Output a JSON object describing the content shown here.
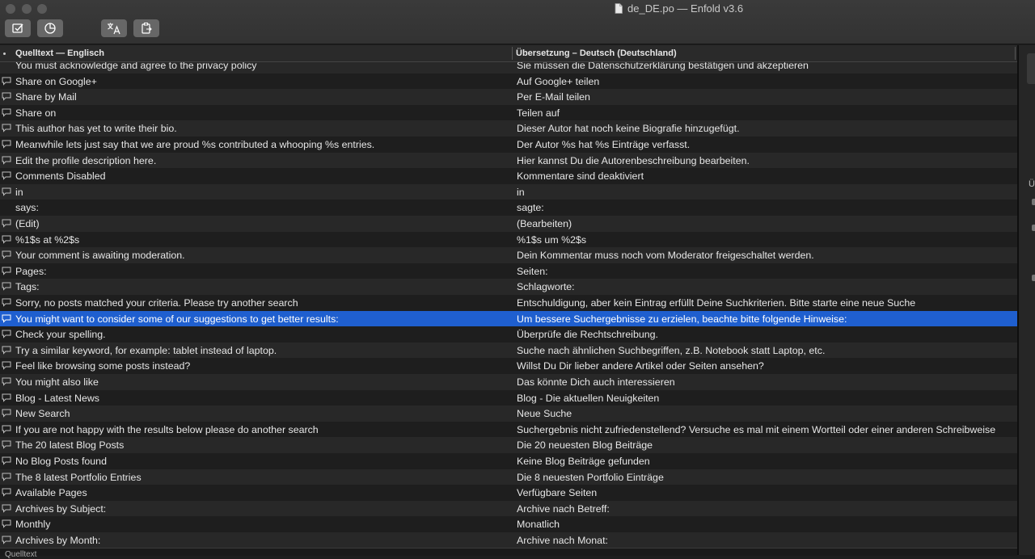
{
  "window": {
    "title": "de_DE.po — Enfold v3.6"
  },
  "toolbar": {
    "buttons": [
      {
        "icon": "checkmark-box-icon"
      },
      {
        "icon": "pie-chart-icon"
      },
      {
        "icon": "translate-icon"
      },
      {
        "icon": "clipboard-icon"
      }
    ]
  },
  "table": {
    "headers": {
      "source": "Quelltext — Englisch",
      "translation": "Übersetzung – Deutsch (Deutschland)"
    },
    "rows": [
      {
        "source": "You must acknowledge and agree to the privacy policy",
        "translation": "Sie müssen die Datenschutzerklärung bestätigen und akzeptieren",
        "comment": false
      },
      {
        "source": "Share on Google+",
        "translation": "Auf Google+ teilen",
        "comment": true
      },
      {
        "source": "Share by Mail",
        "translation": "Per E-Mail teilen",
        "comment": true
      },
      {
        "source": "Share on",
        "translation": "Teilen auf",
        "comment": true
      },
      {
        "source": "This author has yet to write their bio.",
        "translation": "Dieser Autor hat noch keine Biografie hinzugefügt.",
        "comment": true
      },
      {
        "source": "Meanwhile lets just say that we are proud %s contributed a whooping %s entries.",
        "translation": "Der Autor %s hat %s Einträge verfasst.",
        "comment": true
      },
      {
        "source": "Edit the profile description here.",
        "translation": "Hier kannst Du die Autorenbeschreibung bearbeiten.",
        "comment": true
      },
      {
        "source": "Comments Disabled",
        "translation": "Kommentare sind deaktiviert",
        "comment": true
      },
      {
        "source": "in",
        "translation": "in",
        "comment": true
      },
      {
        "source": "says:",
        "translation": "sagte:",
        "comment": false
      },
      {
        "source": "(Edit)",
        "translation": "(Bearbeiten)",
        "comment": true
      },
      {
        "source": "%1$s at %2$s",
        "translation": "%1$s um %2$s",
        "comment": true
      },
      {
        "source": "Your comment is awaiting moderation.",
        "translation": "Dein Kommentar muss noch vom Moderator freigeschaltet werden.",
        "comment": true
      },
      {
        "source": "Pages:",
        "translation": "Seiten:",
        "comment": true
      },
      {
        "source": "Tags:",
        "translation": "Schlagworte:",
        "comment": true
      },
      {
        "source": "Sorry, no posts matched your criteria. Please try another search",
        "translation": "Entschuldigung, aber kein Eintrag erfüllt Deine Suchkriterien. Bitte starte eine neue Suche",
        "comment": true
      },
      {
        "source": "You might want to consider some of our suggestions to get better results:",
        "translation": "Um bessere Suchergebnisse zu erzielen, beachte bitte folgende Hinweise:",
        "comment": true,
        "selected": true
      },
      {
        "source": "Check your spelling.",
        "translation": "Überprüfe die Rechtschreibung.",
        "comment": true
      },
      {
        "source": "Try a similar keyword, for example: tablet instead of laptop.",
        "translation": "Suche nach ähnlichen Suchbegriffen, z.B. Notebook statt Laptop, etc.",
        "comment": true
      },
      {
        "source": "Feel like browsing some posts instead?",
        "translation": "Willst Du Dir lieber andere Artikel oder Seiten ansehen?",
        "comment": true
      },
      {
        "source": "You might also like",
        "translation": "Das könnte Dich auch interessieren",
        "comment": true
      },
      {
        "source": "Blog - Latest News",
        "translation": "Blog - Die aktuellen Neuigkeiten",
        "comment": true
      },
      {
        "source": "New Search",
        "translation": "Neue Suche",
        "comment": true
      },
      {
        "source": "If you are not happy with the results below please do another search",
        "translation": "Suchergebnis nicht zufriedenstellend? Versuche es mal mit einem Wortteil oder einer anderen Schreibweise",
        "comment": true
      },
      {
        "source": "The 20 latest Blog Posts",
        "translation": "Die 20 neuesten Blog Beiträge",
        "comment": true
      },
      {
        "source": "No Blog Posts found",
        "translation": "Keine Blog Beiträge gefunden",
        "comment": true
      },
      {
        "source": "The 8 latest Portfolio Entries",
        "translation": "Die 8 neuesten Portfolio Einträge",
        "comment": true
      },
      {
        "source": "Available Pages",
        "translation": "Verfügbare Seiten",
        "comment": true
      },
      {
        "source": "Archives by Subject:",
        "translation": "Archive nach Betreff:",
        "comment": true
      },
      {
        "source": "Monthly",
        "translation": "Monatlich",
        "comment": true
      },
      {
        "source": "Archives by Month:",
        "translation": "Archive nach Monat:",
        "comment": true
      }
    ]
  },
  "sidebar": {
    "glyph_label": "Ü"
  },
  "bottom": {
    "label": "Quelltext"
  }
}
